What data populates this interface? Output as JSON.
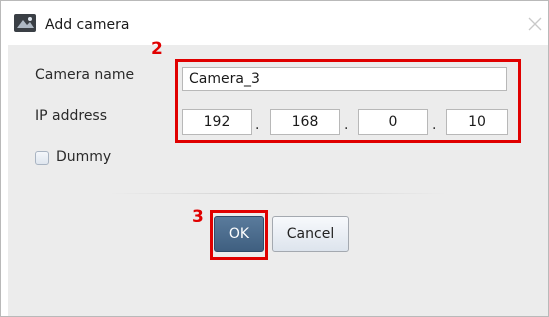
{
  "window": {
    "title": "Add camera",
    "app_icon": "camera-app-icon",
    "close_icon": "close-icon"
  },
  "form": {
    "camera_name_label": "Camera name",
    "camera_name_value": "Camera_3",
    "ip_label": "IP address",
    "ip_octets": [
      "192",
      "168",
      "0",
      "10"
    ],
    "ip_separator": ".",
    "dummy_label": "Dummy",
    "dummy_checked": false
  },
  "buttons": {
    "ok_label": "OK",
    "cancel_label": "Cancel"
  },
  "annotations": {
    "callout_2": "2",
    "callout_3": "3",
    "highlight_color": "#e00000"
  }
}
